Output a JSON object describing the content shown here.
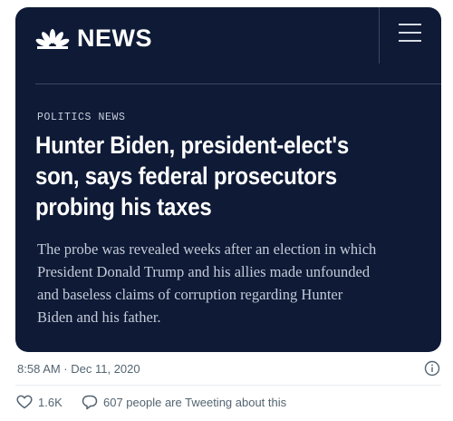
{
  "card": {
    "brand": "NEWS",
    "section": "POLITICS NEWS",
    "headline_lines": [
      "Hunter Biden, president-elect's",
      "son, says federal prosecutors",
      "probing his taxes"
    ],
    "summary_lines": [
      "The probe was revealed weeks after an election in which",
      "President Donald Trump and his allies made unfounded",
      "and baseless claims of corruption regarding Hunter",
      "Biden and his father."
    ],
    "background_color": "#0e1a36"
  },
  "tweet": {
    "timestamp": "8:58 AM · Dec 11, 2020",
    "likes": "1.6K",
    "tweeting_text": "607 people are Tweeting about this"
  },
  "icons": {
    "logo": "peacock-icon",
    "menu": "hamburger-menu-icon",
    "info": "info-icon",
    "like": "heart-icon",
    "conversation": "speech-bubble-icon"
  }
}
